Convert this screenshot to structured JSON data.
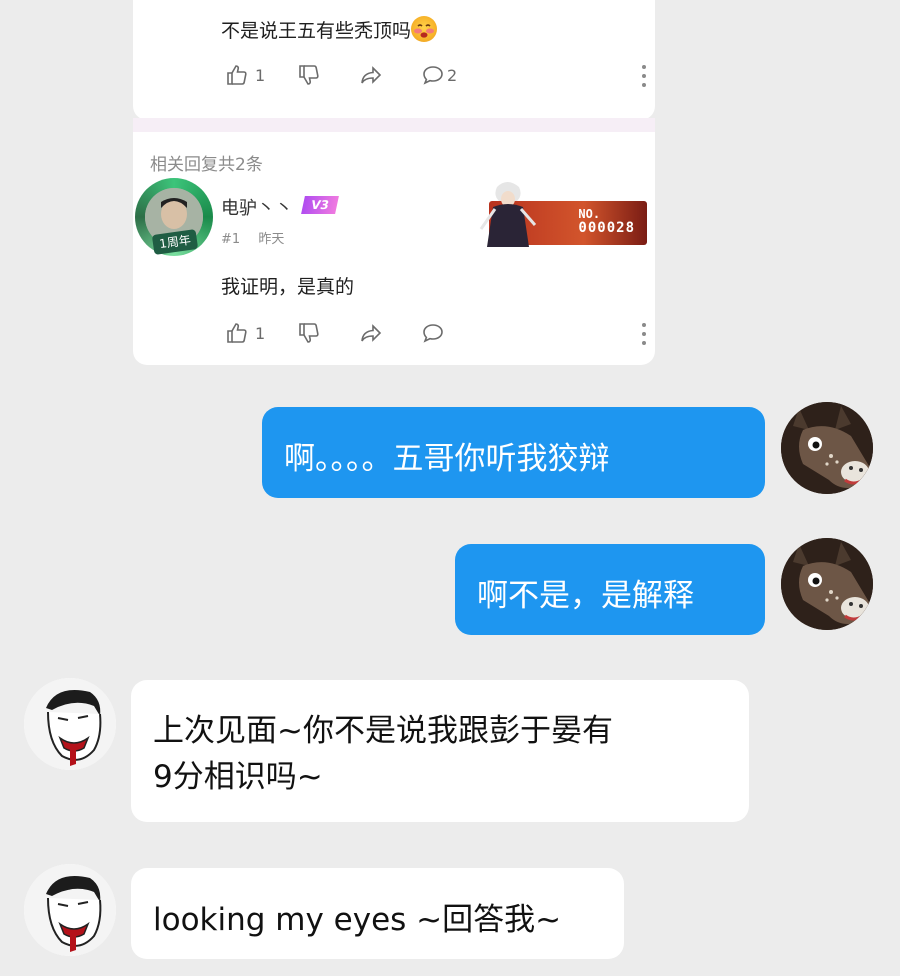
{
  "thread": {
    "top_comment": {
      "text": "不是说王五有些秃顶吗",
      "emoji_icon": "blushing-face-emoji",
      "likes": "1",
      "comments": "2"
    },
    "replies": {
      "header": "相关回复共2条",
      "items": [
        {
          "username": "电驴丶丶",
          "level_badge": "V3",
          "avatar_badge": "1周年",
          "floor": "#1",
          "time": "昨天",
          "card_badge": {
            "line1": "NO.",
            "line2": "000028"
          },
          "text": "我证明，是真的",
          "likes": "1",
          "comments": ""
        }
      ]
    }
  },
  "chat": {
    "messages": [
      {
        "side": "right",
        "text": "啊。。。。五哥你听我狡辩",
        "avatar": "donkey-avatar"
      },
      {
        "side": "right",
        "text": "啊不是，是解释",
        "avatar": "donkey-avatar"
      },
      {
        "side": "left",
        "lines": [
          "上次见面~你不是说我跟彭于晏有",
          "9分相识吗~"
        ],
        "avatar": "sketch-face-avatar"
      },
      {
        "side": "left",
        "text": "looking my eyes ~回答我~",
        "avatar": "sketch-face-avatar"
      }
    ]
  },
  "colors": {
    "background": "#ececec",
    "outgoing_bubble": "#1e96f0",
    "incoming_bubble": "#ffffff",
    "level_badge": "#c35cf0"
  }
}
